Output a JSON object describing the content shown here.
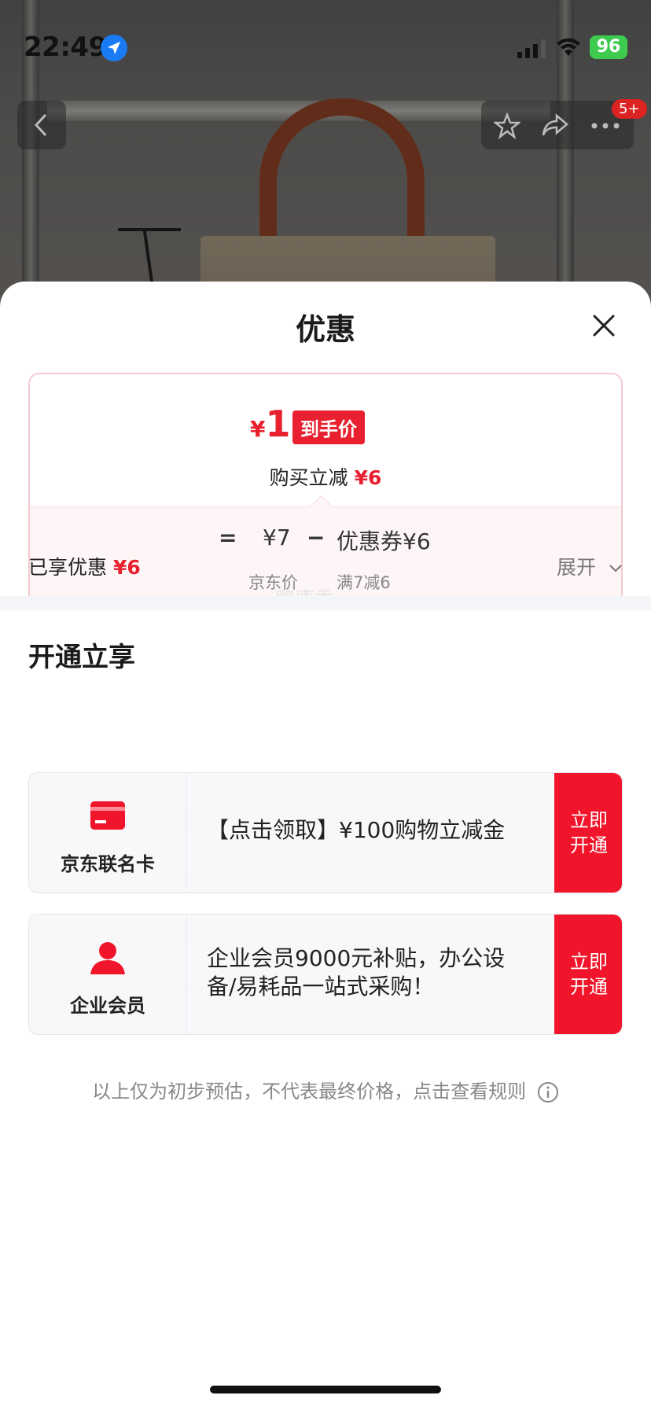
{
  "status_bar": {
    "time": "22:49",
    "battery": "96"
  },
  "nav": {
    "badge": "5+"
  },
  "sheet": {
    "title": "优惠",
    "price_card": {
      "currency": "¥",
      "final_price": "1",
      "final_tag": "到手价",
      "reduce_label": "购买立减",
      "reduce_value": "¥6",
      "formula": {
        "eq": "=",
        "jd_price": "¥7",
        "minus": "−",
        "coupon": "优惠券¥6",
        "jd_price_label": "京东价",
        "coupon_rule": "满7减6"
      }
    },
    "enjoyed_label": "已享优惠",
    "enjoyed_value": "¥6",
    "expand_label": "展开",
    "watermark": "鸭康香",
    "section_title": "开通立享",
    "offers": [
      {
        "label": "京东联名卡",
        "icon": "credit-card-icon",
        "desc": "【点击领取】¥100购物立减金",
        "action": "立即开通"
      },
      {
        "label": "企业会员",
        "icon": "person-icon",
        "desc": "企业会员9000元补贴，办公设备/易耗品一站式采购！",
        "action": "立即开通"
      }
    ],
    "disclaimer": "以上仅为初步预估，不代表最终价格，点击查看规则"
  },
  "colors": {
    "accent": "#e8202f",
    "button": "#f0152a"
  }
}
